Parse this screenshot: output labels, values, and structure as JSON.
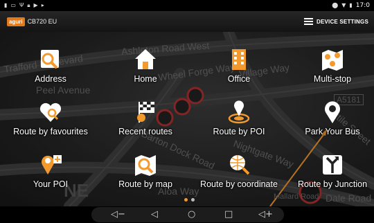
{
  "status_bar": {
    "time": "17:0"
  },
  "header": {
    "brand": "aguri",
    "device": "CB720 EU",
    "settings_label": "DEVICE SETTINGS"
  },
  "map": {
    "streets": [
      "Ashleton Road West",
      "Trafford Boulevard",
      "Wheel Forge Way",
      "Village Way",
      "Peel Avenue",
      "A5181",
      "Textile Street",
      "Barton Dock Road",
      "Nightgate Way",
      "Aloa Way",
      "NE",
      "Mallard Road",
      "Dale Road"
    ]
  },
  "menu": {
    "items": [
      {
        "label": "Address"
      },
      {
        "label": "Home"
      },
      {
        "label": "Office"
      },
      {
        "label": "Multi-stop"
      },
      {
        "label": "Route by favourites"
      },
      {
        "label": "Recent routes"
      },
      {
        "label": "Route by POI"
      },
      {
        "label": "Park Your Bus"
      },
      {
        "label": "Your POI"
      },
      {
        "label": "Route by map"
      },
      {
        "label": "Route by coordinate"
      },
      {
        "label": "Route by Junction"
      }
    ]
  },
  "colors": {
    "accent": "#f29a2e",
    "header": "#1c1c1c",
    "map": "#2a2a2a"
  }
}
